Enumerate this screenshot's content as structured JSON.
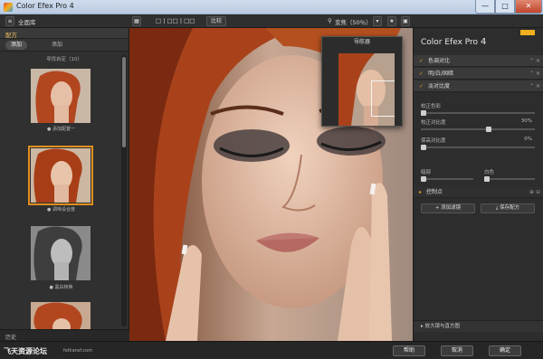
{
  "window": {
    "title": "Color Efex Pro 4",
    "min": "—",
    "max": "□",
    "close": "✕"
  },
  "toolbar": {
    "left_label": "全面库",
    "layout_label": "□ | □□ | □□",
    "compare_label": "比较",
    "zoom_label": "变焦（50％）",
    "zoom_icon": "search-icon"
  },
  "left_panel": {
    "header": "配方",
    "tab_all": "添加",
    "tab_favorites": "添加",
    "section_title": "寻找自定（10）",
    "presets": [
      {
        "label": "● 添加配置一"
      },
      {
        "label": "● 调味设合度"
      },
      {
        "label": "● 黑白转换"
      }
    ],
    "footer": "历史"
  },
  "navigator": {
    "title": "导航器"
  },
  "right_panel": {
    "brand": "Color Efex Pro",
    "brand_version": "4",
    "filters": [
      {
        "check": "✓",
        "label": "色调对比"
      },
      {
        "check": "✓",
        "label": "明/白/固暗"
      },
      {
        "check": "✓",
        "label": "淡对比度"
      }
    ],
    "sliders": [
      {
        "label": "校正色彩",
        "value": "",
        "fraction": 0.0
      },
      {
        "label": "校正对比度",
        "value": "30%",
        "fraction": 0.6
      },
      {
        "label": "保高对比度",
        "value": "0%",
        "fraction": 0.0
      }
    ],
    "shadows_label": "暗部",
    "highlights_label": "白色",
    "control_point": "控制点",
    "add_filter": "添加滤镜",
    "save_recipe": "保存配方",
    "bottom_label": "放大镜与直方图",
    "accent": "#e0a030"
  },
  "bottombar": {
    "watermark": "飞天资源论坛",
    "watermark_url": "feitiansf.com",
    "btn_help": "帮助",
    "btn_cancel": "取消",
    "btn_ok": "确定"
  }
}
